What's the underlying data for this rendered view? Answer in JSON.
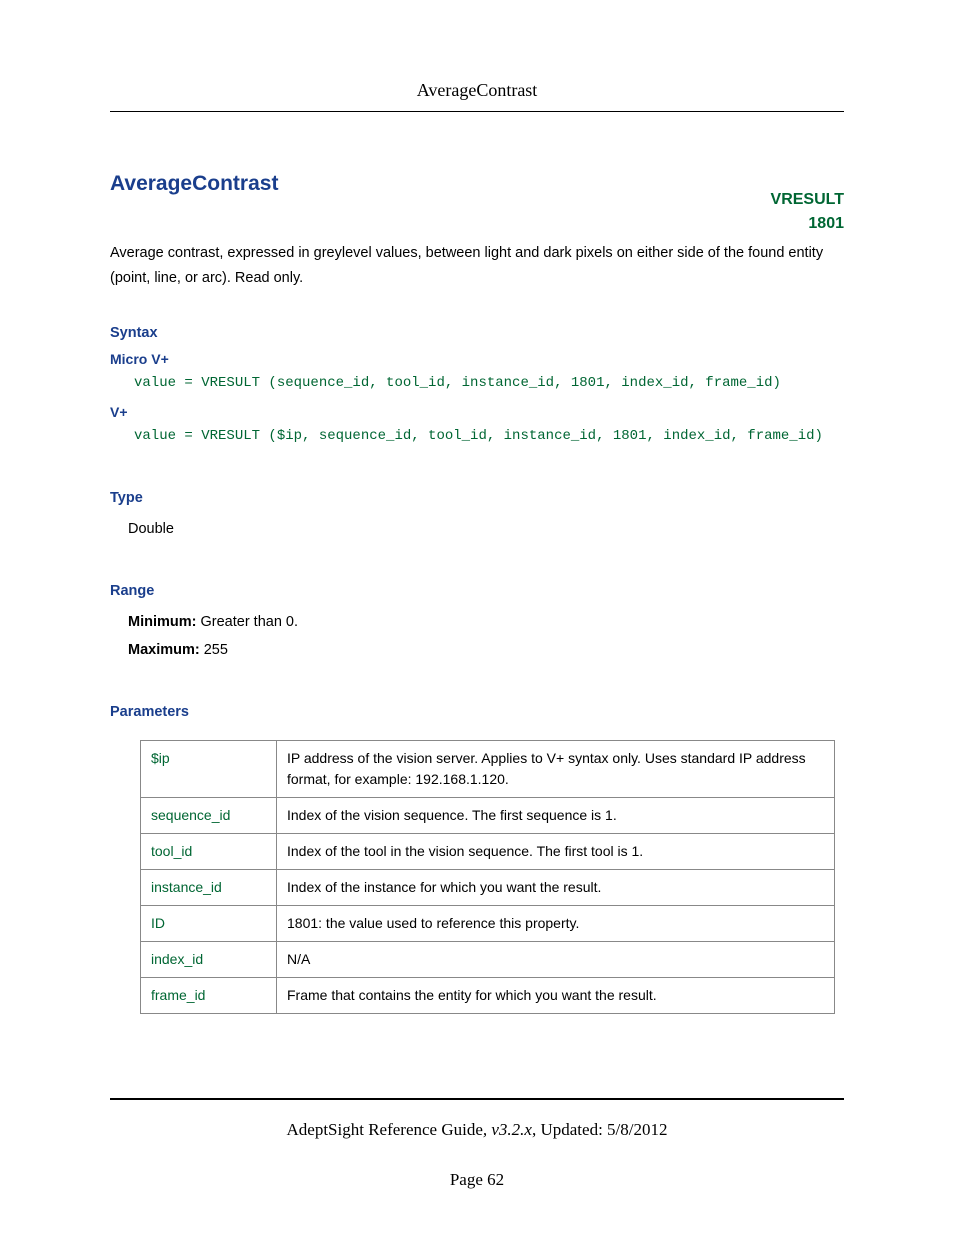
{
  "header": {
    "running_title": "AverageContrast"
  },
  "title": "AverageContrast",
  "vresult": {
    "label": "VRESULT",
    "code": "1801"
  },
  "intro": "Average contrast, expressed in greylevel values, between light and dark pixels on either side of the found entity (point, line, or arc). Read only.",
  "syntax": {
    "heading": "Syntax",
    "micro_label": "Micro V+",
    "micro_code": "value = VRESULT (sequence_id, tool_id, instance_id, 1801, index_id, frame_id)",
    "vplus_label": "V+",
    "vplus_code": "value = VRESULT ($ip, sequence_id, tool_id, instance_id, 1801, index_id, frame_id)"
  },
  "type": {
    "heading": "Type",
    "value": "Double"
  },
  "range": {
    "heading": "Range",
    "min_label": "Minimum:",
    "min_value": " Greater than 0.",
    "max_label": "Maximum:",
    "max_value": " 255"
  },
  "parameters": {
    "heading": "Parameters",
    "rows": [
      {
        "name": "$ip",
        "desc": "IP address of the vision server. Applies to V+ syntax only. Uses standard IP address format, for example: 192.168.1.120."
      },
      {
        "name": "sequence_id",
        "desc": "Index of the vision sequence. The first sequence is 1."
      },
      {
        "name": "tool_id",
        "desc": "Index of the tool in the vision sequence. The first tool is 1."
      },
      {
        "name": "instance_id",
        "desc": "Index of the instance for which you want the result."
      },
      {
        "name": "ID",
        "desc": "1801: the value used to reference this property."
      },
      {
        "name": "index_id",
        "desc": "N/A"
      },
      {
        "name": "frame_id",
        "desc": "Frame that contains the entity for which you want the result."
      }
    ]
  },
  "footer": {
    "guide": "AdeptSight Reference Guide",
    "version": ", v3.2.x",
    "updated": ", Updated: 5/8/2012",
    "page": "Page 62"
  }
}
